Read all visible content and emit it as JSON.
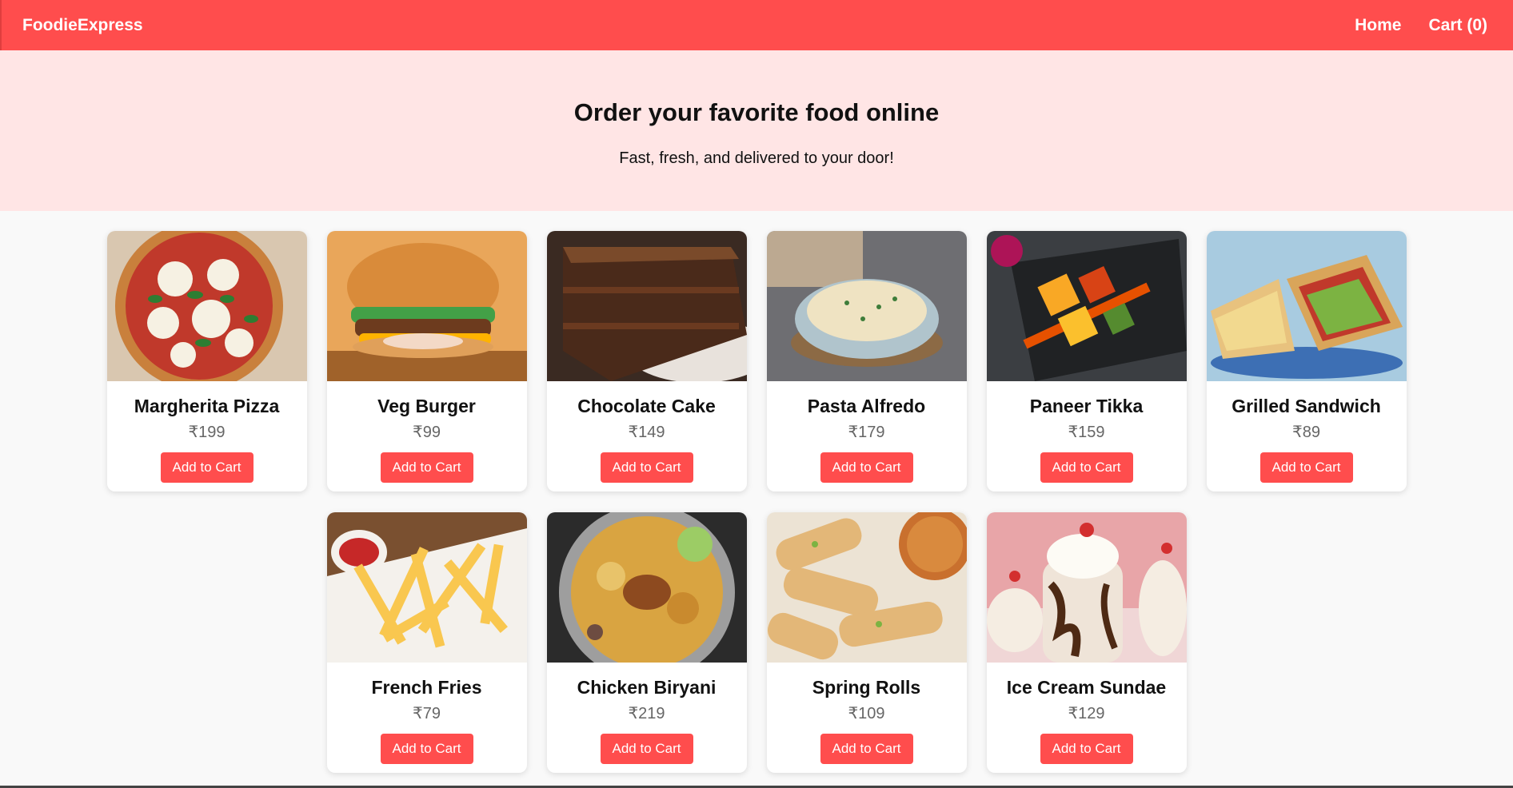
{
  "brand": "FoodieExpress",
  "nav": {
    "home": "Home",
    "cart": "Cart (0)"
  },
  "hero": {
    "title": "Order your favorite food online",
    "subtitle": "Fast, fresh, and delivered to your door!"
  },
  "button_label": "Add to Cart",
  "colors": {
    "primary": "#ff4d4d",
    "hero_bg": "#ffe5e5",
    "page_bg": "#f9f9f9"
  },
  "products": [
    {
      "name": "Margherita Pizza",
      "price": "₹199",
      "image": "pizza"
    },
    {
      "name": "Veg Burger",
      "price": "₹99",
      "image": "burger"
    },
    {
      "name": "Chocolate Cake",
      "price": "₹149",
      "image": "cake"
    },
    {
      "name": "Pasta Alfredo",
      "price": "₹179",
      "image": "pasta"
    },
    {
      "name": "Paneer Tikka",
      "price": "₹159",
      "image": "tikka"
    },
    {
      "name": "Grilled Sandwich",
      "price": "₹89",
      "image": "sandwich"
    },
    {
      "name": "French Fries",
      "price": "₹79",
      "image": "fries"
    },
    {
      "name": "Chicken Biryani",
      "price": "₹219",
      "image": "biryani"
    },
    {
      "name": "Spring Rolls",
      "price": "₹109",
      "image": "rolls"
    },
    {
      "name": "Ice Cream Sundae",
      "price": "₹129",
      "image": "sundae"
    }
  ]
}
